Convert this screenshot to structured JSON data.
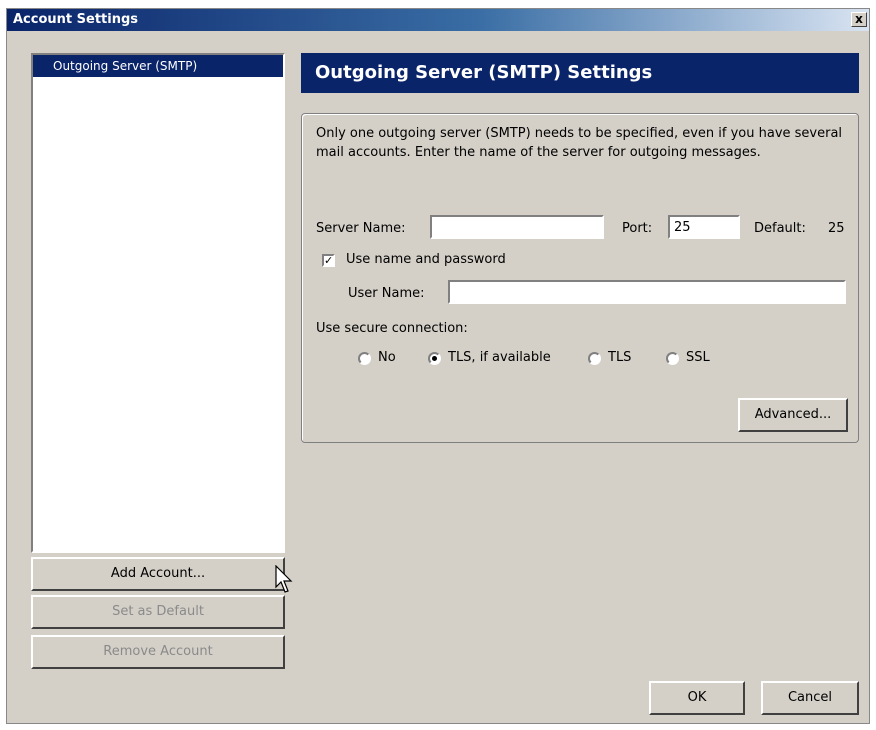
{
  "window": {
    "title": "Account Settings",
    "close_glyph": "x"
  },
  "sidebar": {
    "items": [
      {
        "label": "Outgoing Server (SMTP)",
        "selected": true
      }
    ],
    "buttons": {
      "add_account": "Add Account...",
      "set_as_default": "Set as Default",
      "remove_account": "Remove Account"
    }
  },
  "main": {
    "header_title": "Outgoing Server (SMTP) Settings",
    "description": "Only one outgoing server (SMTP) needs to be specified, even if you have several mail accounts. Enter the name of the server for outgoing messages.",
    "server_name_label": "Server Name:",
    "server_name_value": "",
    "port_label": "Port:",
    "port_value": "25",
    "default_label": "Default:",
    "default_value": "25",
    "use_name_password_label": "Use name and password",
    "use_name_password_checked": true,
    "user_name_label": "User Name:",
    "user_name_value": "",
    "secure_connection_label": "Use secure connection:",
    "secure_options": [
      {
        "label": "No",
        "checked": false
      },
      {
        "label": "TLS, if available",
        "checked": true
      },
      {
        "label": "TLS",
        "checked": false
      },
      {
        "label": "SSL",
        "checked": false
      }
    ],
    "advanced_button": "Advanced..."
  },
  "footer": {
    "ok_label": "OK",
    "cancel_label": "Cancel"
  },
  "icons": {
    "checkmark": "check-icon",
    "cursor": "mouse-pointer-icon"
  }
}
